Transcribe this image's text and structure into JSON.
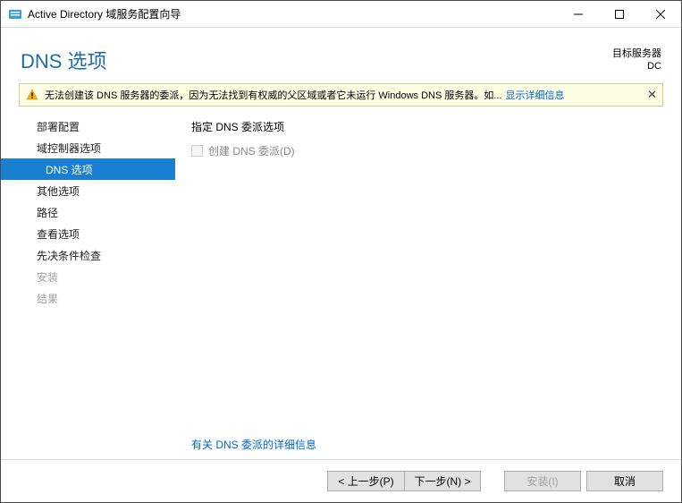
{
  "titlebar": {
    "title": "Active Directory 域服务配置向导"
  },
  "header": {
    "page_title": "DNS 选项",
    "target_label": "目标服务器",
    "target_value": "DC"
  },
  "warning": {
    "text": "无法创建该 DNS 服务器的委派，因为无法找到有权威的父区域或者它未运行 Windows DNS 服务器。如...",
    "link": "显示详细信息"
  },
  "sidebar": {
    "items": [
      {
        "label": "部署配置",
        "active": false,
        "disabled": false
      },
      {
        "label": "域控制器选项",
        "active": false,
        "disabled": false
      },
      {
        "label": "DNS 选项",
        "active": true,
        "disabled": false
      },
      {
        "label": "其他选项",
        "active": false,
        "disabled": false
      },
      {
        "label": "路径",
        "active": false,
        "disabled": false
      },
      {
        "label": "查看选项",
        "active": false,
        "disabled": false
      },
      {
        "label": "先决条件检查",
        "active": false,
        "disabled": false
      },
      {
        "label": "安装",
        "active": false,
        "disabled": true
      },
      {
        "label": "结果",
        "active": false,
        "disabled": true
      }
    ]
  },
  "main": {
    "section_label": "指定 DNS 委派选项",
    "checkbox_label": "创建 DNS 委派(D)",
    "info_link": "有关 DNS 委派的详细信息"
  },
  "footer": {
    "prev": "< 上一步(P)",
    "next": "下一步(N) >",
    "install": "安装(I)",
    "cancel": "取消"
  }
}
